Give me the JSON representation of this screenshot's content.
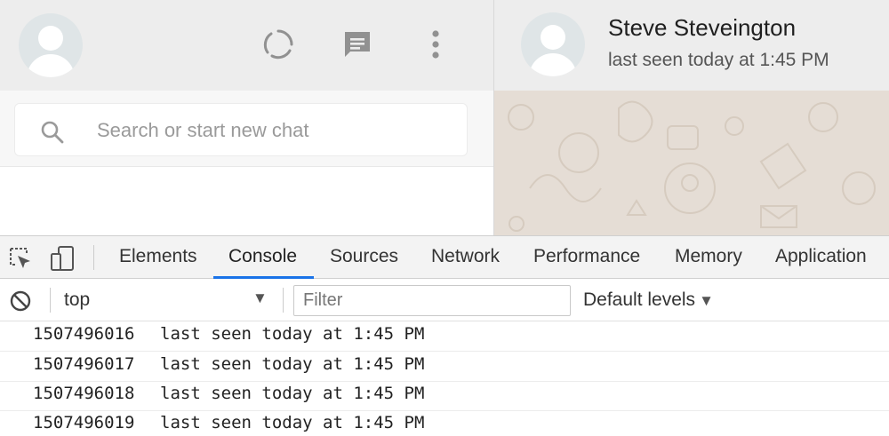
{
  "app": {
    "left_header": {
      "my_avatar_icon": "default-avatar",
      "status_icon": "status-ring",
      "new_chat_icon": "chat-bubble",
      "menu_icon": "vertical-dots"
    },
    "search": {
      "placeholder": "Search or start new chat",
      "icon": "magnifier"
    },
    "conversation": {
      "contact_name": "Steve Steveington",
      "contact_status": "last seen today at 1:45 PM"
    },
    "colors": {
      "header_bg": "#ededed",
      "chat_wallpaper": "#e5ddd5",
      "icon_gray": "#919191"
    }
  },
  "devtools": {
    "tabs": [
      {
        "label": "Elements",
        "active": false
      },
      {
        "label": "Console",
        "active": true
      },
      {
        "label": "Sources",
        "active": false
      },
      {
        "label": "Network",
        "active": false
      },
      {
        "label": "Performance",
        "active": false
      },
      {
        "label": "Memory",
        "active": false
      },
      {
        "label": "Application",
        "active": false
      }
    ],
    "console_toolbar": {
      "context": "top",
      "context_arrow": "▼",
      "filter_placeholder": "Filter",
      "levels": "Default levels",
      "levels_arrow": "▼"
    },
    "logs": [
      {
        "timestamp": "1507496016",
        "message": "last seen today at 1:45 PM"
      },
      {
        "timestamp": "1507496017",
        "message": "last seen today at 1:45 PM"
      },
      {
        "timestamp": "1507496018",
        "message": "last seen today at 1:45 PM"
      },
      {
        "timestamp": "1507496019",
        "message": "last seen today at 1:45 PM"
      }
    ],
    "colors": {
      "tabbar_bg": "#f3f3f3",
      "active_tab_underline": "#1a73e8"
    }
  }
}
